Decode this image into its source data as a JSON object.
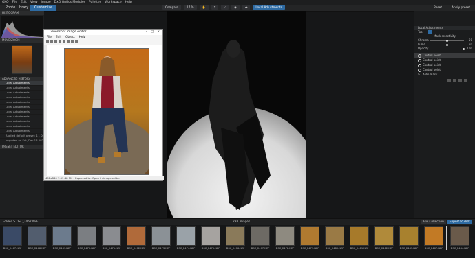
{
  "menubar": [
    "OXO",
    "File",
    "Edit",
    "View",
    "Image",
    "DxO Optics Modules",
    "Palettes",
    "Workspace",
    "Help"
  ],
  "tabs": {
    "library": "Photo Library",
    "customize": "Customize"
  },
  "viewer_toolbar": {
    "compare": "Compare",
    "zoom": "17 %",
    "local_adjustments": "Local Adjustments"
  },
  "right_top": {
    "reset": "Reset",
    "apply_preset": "Apply preset"
  },
  "left_panel": {
    "histogram": "HISTOGRAM",
    "move_zoom": "MOVE/ZOOM",
    "advanced_history": "ADVANCED HISTORY",
    "history_rows": [
      "Local Adjustments",
      "Local Adjustments",
      "Local Adjustments",
      "Local Adjustments",
      "Local Adjustments",
      "Local Adjustments",
      "Local Adjustments",
      "Local Adjustments",
      "Local Adjustments",
      "Local Adjustments",
      "Local Adjustments",
      "Applied default preset: 1 - DxO Stan…",
      "Imported on Sat, Dec 18 2021 8:39:51 PM"
    ],
    "preset_editor": "PRESET EDITOR"
  },
  "editor_window": {
    "title": "Greenshot image editor",
    "menu": [
      "File",
      "Edit",
      "Object",
      "Help"
    ],
    "status": "492x880  7:59:48 PM - Exported to: Open in image editor"
  },
  "right_panel": {
    "title": "Local Adjustments",
    "tool": "Tool",
    "mask_selectivity": "Mask selectivity",
    "sliders": [
      {
        "label": "Chroma",
        "value": "50"
      },
      {
        "label": "Luma",
        "value": "50"
      },
      {
        "label": "Opacity",
        "value": "100"
      }
    ],
    "control_points": [
      "Control point",
      "Control point",
      "Control point",
      "Control point"
    ],
    "auto_mask": "Auto mask"
  },
  "filmbar": {
    "path": "Folder > DSC_2467.NEF",
    "count": "238 images",
    "file_collection": "File Collection",
    "export": "Export to disk"
  },
  "filmstrip": [
    {
      "name": "DSC_2467.NEF",
      "color": "#3a4a66"
    },
    {
      "name": "DSC_2468.NEF",
      "color": "#525d6e"
    },
    {
      "name": "DSC_2469.NEF",
      "color": "#6c7b8d"
    },
    {
      "name": "DSC_2470.NEF",
      "color": "#7b7e82"
    },
    {
      "name": "DSC_2471.NEF",
      "color": "#8a8c90"
    },
    {
      "name": "DSC_2472.NEF",
      "color": "#b06a3a"
    },
    {
      "name": "DSC_2473.NEF",
      "color": "#8b9196"
    },
    {
      "name": "DSC_2474.NEF",
      "color": "#9aa2a8"
    },
    {
      "name": "DSC_2475.NEF",
      "color": "#a6a3a0"
    },
    {
      "name": "DSC_2476.NEF",
      "color": "#8a7a5a"
    },
    {
      "name": "DSC_2477.NEF",
      "color": "#6d6a64"
    },
    {
      "name": "DSC_2478.NEF",
      "color": "#8e8a80"
    },
    {
      "name": "DSC_2479.NEF",
      "color": "#b07a30"
    },
    {
      "name": "DSC_2480.NEF",
      "color": "#9a7a45"
    },
    {
      "name": "DSC_2481.NEF",
      "color": "#a77a2a"
    },
    {
      "name": "DSC_2482.NEF",
      "color": "#b08a3a"
    },
    {
      "name": "DSC_2483.NEF",
      "color": "#a8812e"
    },
    {
      "name": "DSC_2467.NEF",
      "color": "#c27a25"
    },
    {
      "name": "DSC_2484.NEF",
      "color": "#6a5a4a"
    }
  ]
}
